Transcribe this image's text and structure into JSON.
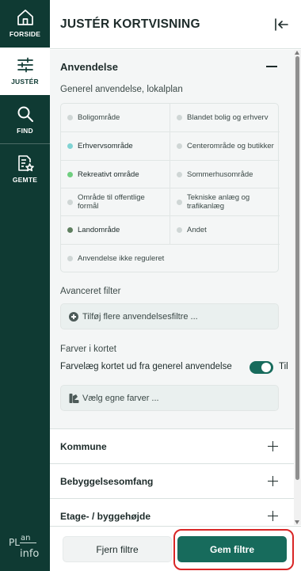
{
  "rail": {
    "items": [
      {
        "label": "FORSIDE",
        "icon": "home-icon"
      },
      {
        "label": "JUSTÉR",
        "icon": "sliders-icon",
        "active": true
      },
      {
        "label": "FIND",
        "icon": "search-icon"
      },
      {
        "label": "GEMTE",
        "icon": "saved-doc-star-icon"
      }
    ],
    "logo": {
      "line1": "PL",
      "line2": "an",
      "line3": "info"
    }
  },
  "panel": {
    "title": "JUSTÉR KORTVISNING",
    "collapse_icon": "collapse-left-icon"
  },
  "usage": {
    "title": "Anvendelse",
    "subtitle": "Generel anvendelse, lokalplan",
    "categories": [
      {
        "label": "Boligområde",
        "color": "#cfd6d5"
      },
      {
        "label": "Blandet bolig og erhverv",
        "color": "#cfd6d5"
      },
      {
        "label": "Erhvervsområde",
        "color": "#7fd3d3"
      },
      {
        "label": "Centerområde og butikker",
        "color": "#cfd6d5"
      },
      {
        "label": "Rekreativt område",
        "color": "#6fce7f"
      },
      {
        "label": "Sommerhusområde",
        "color": "#cfd6d5"
      },
      {
        "label": "Område til offentlige formål",
        "color": "#cfd6d5"
      },
      {
        "label": "Tekniske anlæg og trafikanlæg",
        "color": "#cfd6d5"
      },
      {
        "label": "Landområde",
        "color": "#5e7f5f"
      },
      {
        "label": "Andet",
        "color": "#cfd6d5"
      },
      {
        "label": "Anvendelse ikke reguleret",
        "color": "#cfd6d5"
      }
    ],
    "advanced_label": "Avanceret filter",
    "add_filter_label": "Tilføj flere anvendelsesfiltre ...",
    "colors_label": "Farver i kortet",
    "toggle_label": "Farvelæg kortet ud fra generel anvendelse",
    "toggle_state": "Til",
    "custom_colors_label": "Vælg egne farver ..."
  },
  "accordions": [
    {
      "label": "Kommune"
    },
    {
      "label": "Bebyggelsesomfang"
    },
    {
      "label": "Etage- / byggehøjde"
    }
  ],
  "footer": {
    "clear_label": "Fjern filtre",
    "save_label": "Gem filtre"
  },
  "colors": {
    "rail_bg": "#0f3a33",
    "accent": "#176b5c",
    "highlight": "#d92626"
  }
}
